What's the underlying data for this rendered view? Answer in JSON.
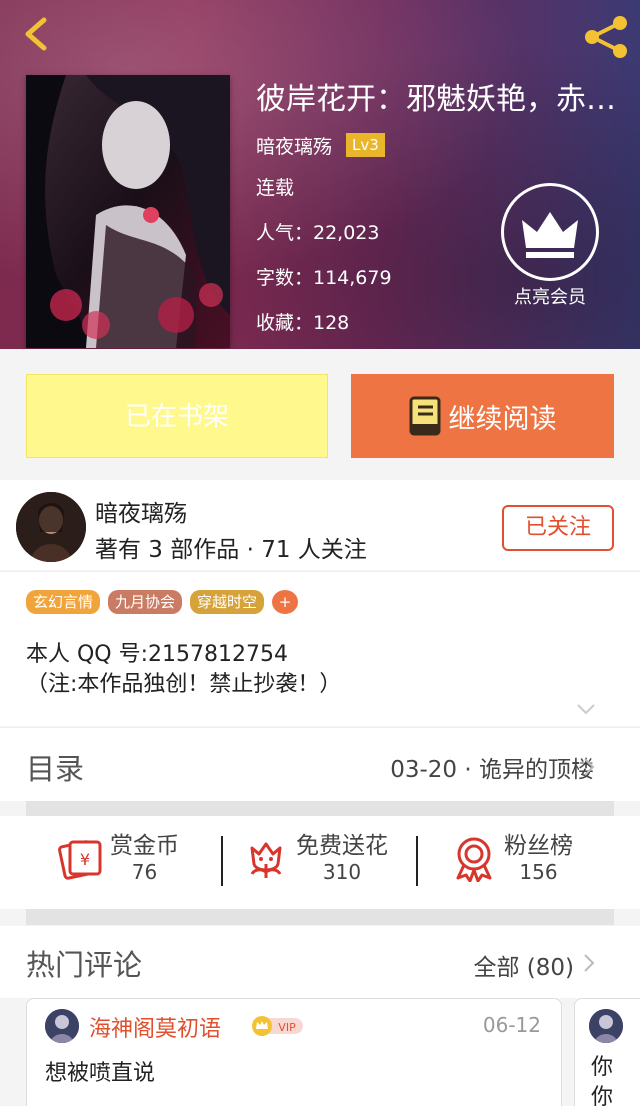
{
  "book": {
    "title": "彼岸花开：邪魅妖艳，赤…",
    "author": "暗夜璃殇",
    "level": "Lv3",
    "status": "连载",
    "popularity": "人气：22,023",
    "word_count": "字数：114,679",
    "favorites": "收藏：128",
    "vip_label": "点亮会员"
  },
  "actions": {
    "shelf_label": "已在书架",
    "read_label": "继续阅读"
  },
  "author": {
    "name": "暗夜璃殇",
    "stats": "著有 3 部作品 · 71 人关注",
    "follow_label": "已关注"
  },
  "tags": [
    {
      "label": "玄幻言情",
      "color": "#f0a43a"
    },
    {
      "label": "九月协会",
      "color": "#c97b64"
    },
    {
      "label": "穿越时空",
      "color": "#d6a23a"
    },
    {
      "label": "+",
      "color": "#ee7543"
    }
  ],
  "description": {
    "line1": "本人 QQ 号:2157812754",
    "line2": "（注:本作品独创！禁止抄袭！）"
  },
  "toc": {
    "title": "目录",
    "latest": "03-20 · 诡异的顶楼"
  },
  "stats": [
    {
      "label": "赏金币",
      "value": "76",
      "icon": "red-envelope-icon"
    },
    {
      "label": "免费送花",
      "value": "310",
      "icon": "flower-icon"
    },
    {
      "label": "粉丝榜",
      "value": "156",
      "icon": "medal-icon"
    }
  ],
  "comments": {
    "title": "热门评论",
    "all_label": "全部 (80)",
    "items": [
      {
        "user": "海神阁莫初语",
        "badge": "VIP",
        "date": "06-12",
        "text": "想被喷直说"
      },
      {
        "text": "你你"
      }
    ]
  },
  "colors": {
    "accent": "#ee7543",
    "follow_red": "#e0502e",
    "shelf_yellow": "#fff88c",
    "level_gold": "#e9b52a"
  }
}
